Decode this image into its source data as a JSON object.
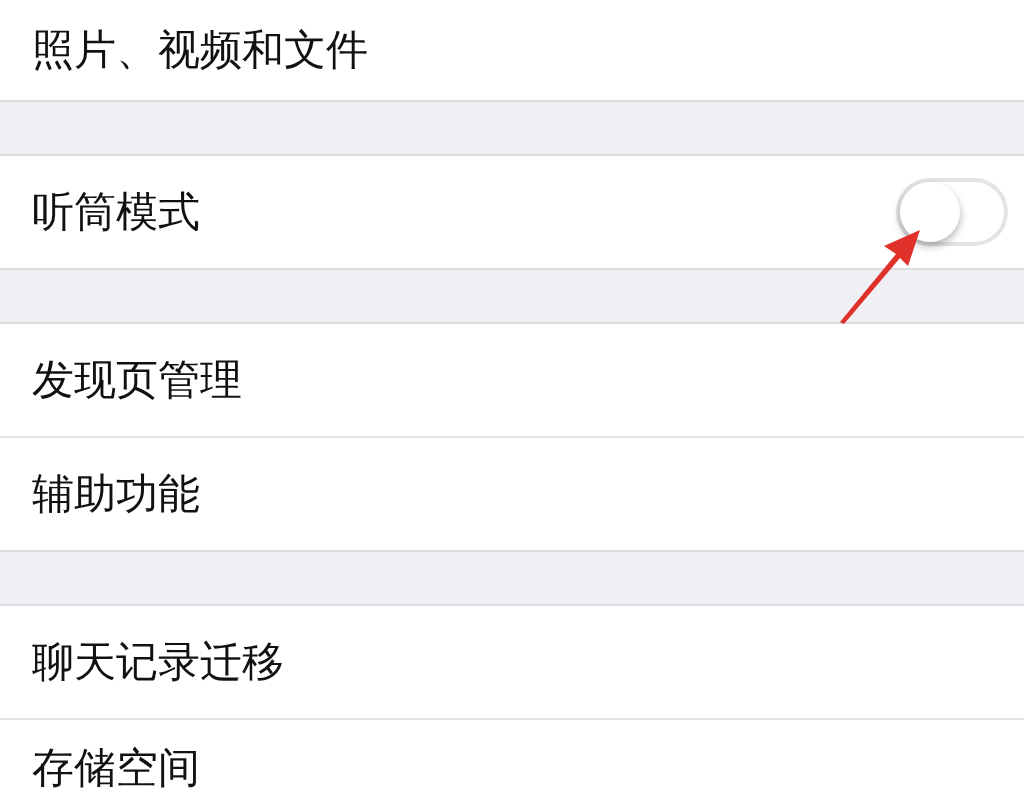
{
  "sections": [
    {
      "rows": [
        {
          "kind": "plain",
          "label": "照片、视频和文件"
        }
      ]
    },
    {
      "rows": [
        {
          "kind": "toggle",
          "label": "听筒模式",
          "on": false
        }
      ]
    },
    {
      "rows": [
        {
          "kind": "plain",
          "label": "发现页管理"
        },
        {
          "kind": "plain",
          "label": "辅助功能"
        }
      ]
    },
    {
      "rows": [
        {
          "kind": "plain",
          "label": "聊天记录迁移"
        },
        {
          "kind": "plain",
          "label": "存储空间"
        }
      ]
    }
  ]
}
